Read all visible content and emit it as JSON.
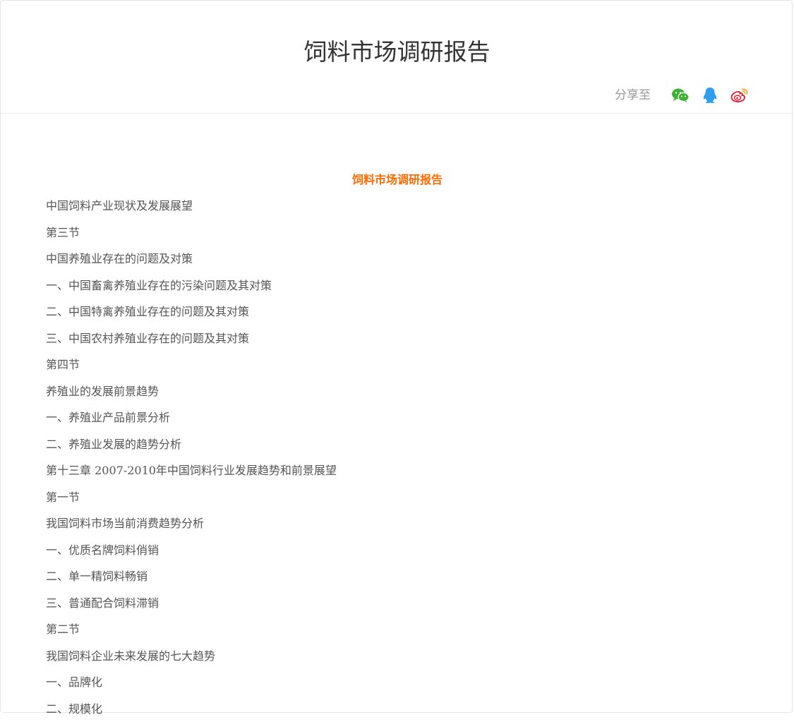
{
  "header": {
    "title": "饲料市场调研报告",
    "share_label": "分享至",
    "share_icons": [
      {
        "icon": "wechat-icon",
        "color": "#3eb135"
      },
      {
        "icon": "qq-icon",
        "color": "#2f9ef0"
      },
      {
        "icon": "weibo-icon",
        "color": "#e6162d"
      }
    ]
  },
  "article": {
    "heading": "饲料市场调研报告",
    "heading_color": "#ff6a00",
    "lines": [
      "中国饲料产业现状及发展展望",
      "第三节",
      "中国养殖业存在的问题及对策",
      "一、中国畜禽养殖业存在的污染问题及其对策",
      "二、中国特禽养殖业存在的问题及其对策",
      "三、中国农村养殖业存在的问题及其对策",
      "第四节",
      "养殖业的发展前景趋势",
      "一、养殖业产品前景分析",
      "二、养殖业发展的趋势分析",
      "第十三章 2007-2010年中国饲料行业发展趋势和前景展望",
      "第一节",
      "我国饲料市场当前消费趋势分析",
      "一、优质名牌饲料俏销",
      "二、单一精饲料畅销",
      "三、普通配合饲料滞销",
      "第二节",
      "我国饲料企业未来发展的七大趋势",
      "一、品牌化",
      "二、规模化"
    ]
  }
}
